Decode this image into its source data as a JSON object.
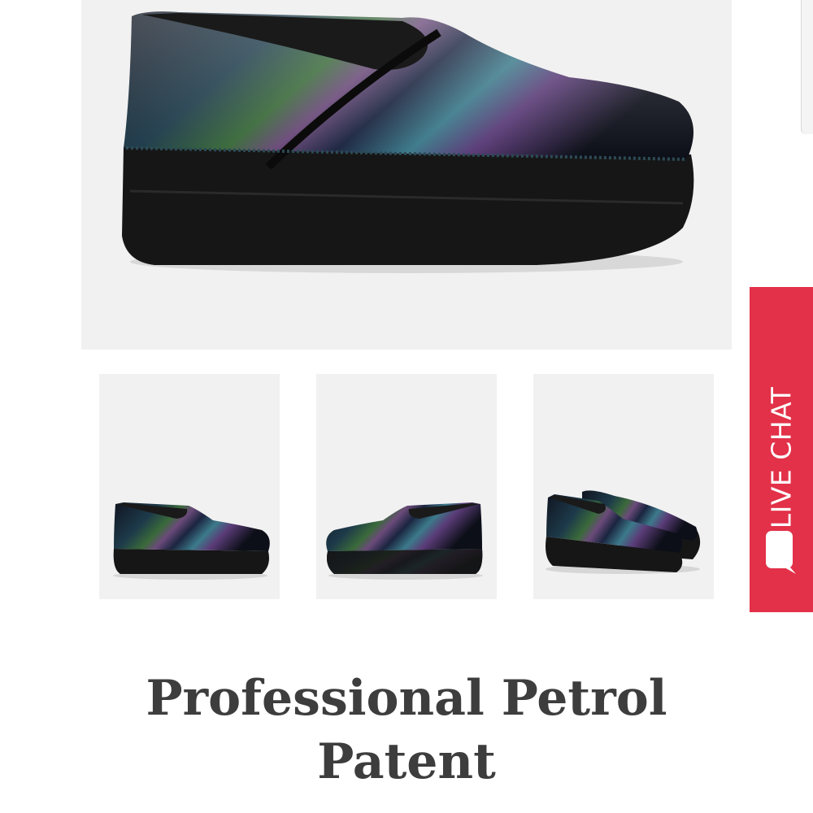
{
  "product": {
    "title": "Professional Petrol Patent",
    "main_image": "iridescent-black-patent-clog-side-view",
    "thumbnails": [
      {
        "view": "side-view"
      },
      {
        "view": "side-view-reversed"
      },
      {
        "view": "pair-angle-view"
      }
    ]
  },
  "live_chat": {
    "label": "LIVE CHAT",
    "icon": "chat-bubble-icon",
    "color": "#e23148"
  },
  "colors": {
    "title_text": "#3d3d3d",
    "image_background": "#f1f1f1"
  }
}
